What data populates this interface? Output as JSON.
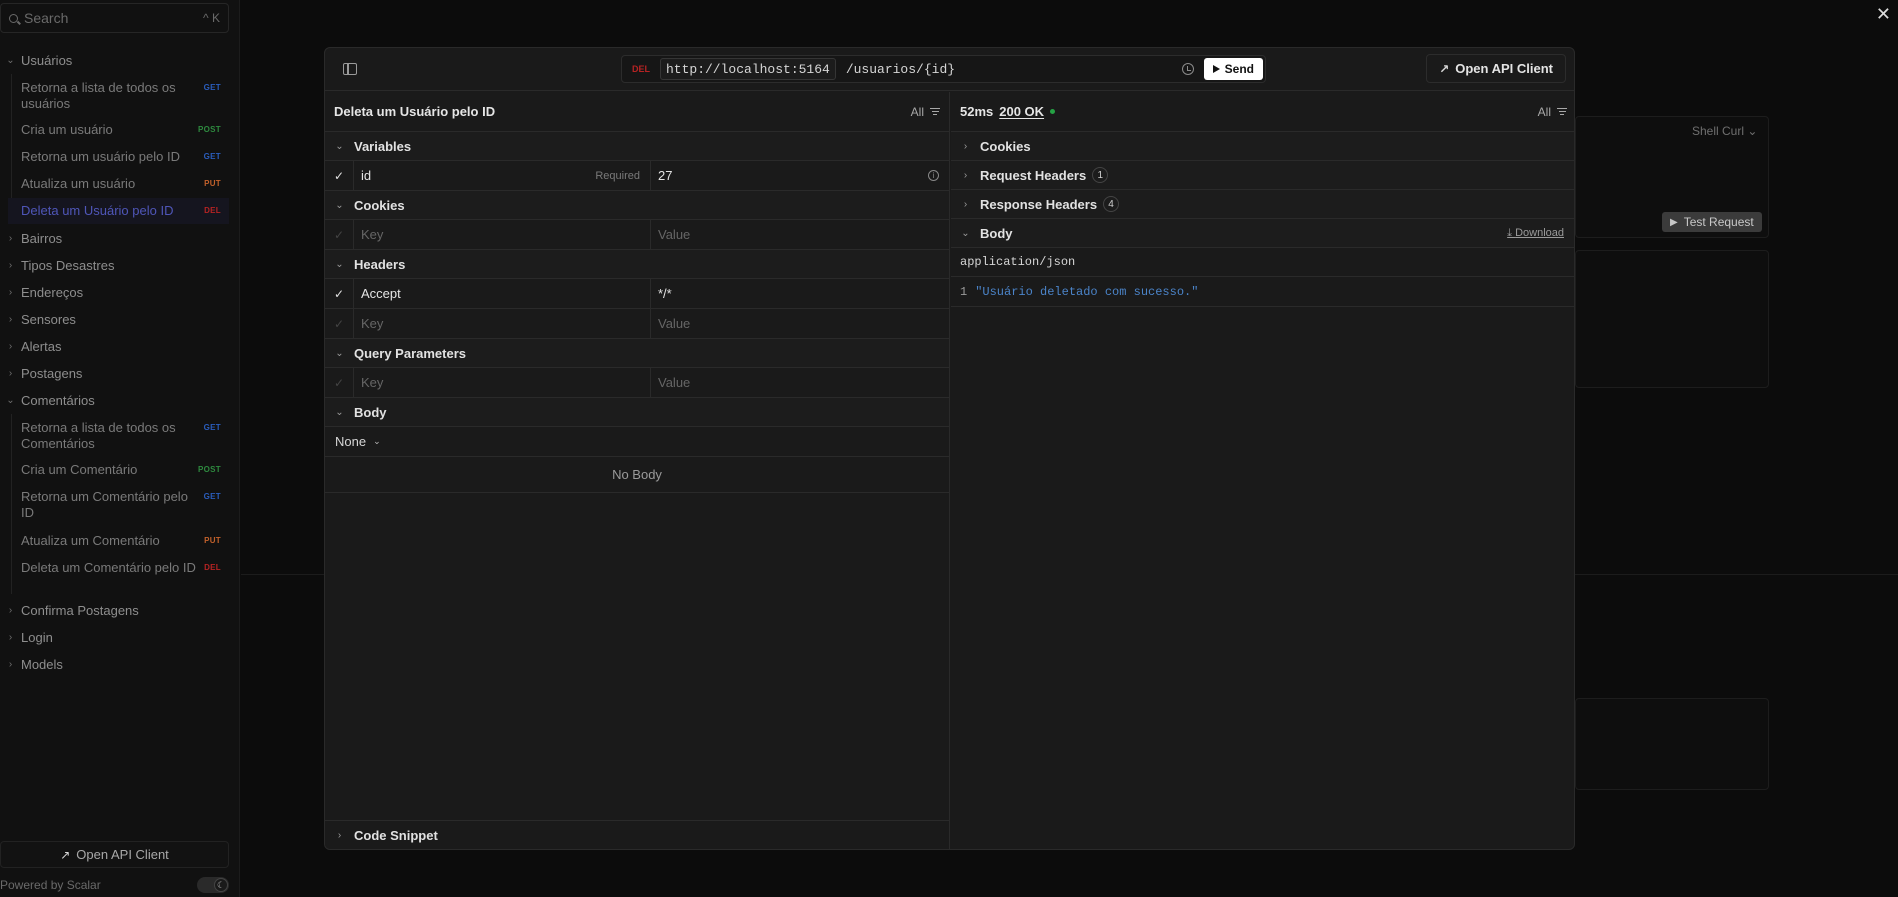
{
  "sidebar": {
    "search_placeholder": "Search",
    "search_shortcut": "^ K",
    "groups": [
      {
        "label": "Usuários",
        "expanded": true
      },
      {
        "label": "Bairros",
        "expanded": false
      },
      {
        "label": "Tipos Desastres",
        "expanded": false
      },
      {
        "label": "Endereços",
        "expanded": false
      },
      {
        "label": "Sensores",
        "expanded": false
      },
      {
        "label": "Alertas",
        "expanded": false
      },
      {
        "label": "Postagens",
        "expanded": false
      },
      {
        "label": "Comentários",
        "expanded": true
      },
      {
        "label": "Confirma Postagens",
        "expanded": false
      },
      {
        "label": "Login",
        "expanded": false
      },
      {
        "label": "Models",
        "expanded": false
      }
    ],
    "usuarios_items": [
      {
        "label": "Retorna a lista de todos os usuários",
        "method": "GET"
      },
      {
        "label": "Cria um usuário",
        "method": "POST"
      },
      {
        "label": "Retorna um usuário pelo ID",
        "method": "GET"
      },
      {
        "label": "Atualiza um usuário",
        "method": "PUT"
      },
      {
        "label": "Deleta um Usuário pelo ID",
        "method": "DEL"
      }
    ],
    "comentarios_items": [
      {
        "label": "Retorna a lista de todos os Comentários",
        "method": "GET"
      },
      {
        "label": "Cria um Comentário",
        "method": "POST"
      },
      {
        "label": "Retorna um Comentário pelo ID",
        "method": "GET"
      },
      {
        "label": "Atualiza um Comentário",
        "method": "PUT"
      },
      {
        "label": "Deleta um Comentário pelo ID",
        "method": "DEL"
      }
    ],
    "footer_button": "Open API Client",
    "powered_by": "Powered by Scalar"
  },
  "background": {
    "shell_label": "Shell Curl",
    "test_request_label": "Test Request"
  },
  "modal": {
    "method": "DEL",
    "host": "http://localhost:5164",
    "path": "/usuarios/{id}",
    "send_label": "Send",
    "open_api_label": "Open API Client",
    "request": {
      "title": "Deleta um Usuário pelo ID",
      "filter_label": "All",
      "variables_label": "Variables",
      "variable": {
        "key": "id",
        "required_label": "Required",
        "value": "27"
      },
      "cookies_label": "Cookies",
      "key_placeholder": "Key",
      "value_placeholder": "Value",
      "headers_label": "Headers",
      "header": {
        "key": "Accept",
        "value": "*/*"
      },
      "query_label": "Query Parameters",
      "body_label": "Body",
      "body_type": "None",
      "no_body_label": "No Body",
      "code_snippet_label": "Code Snippet"
    },
    "response": {
      "timing": "52ms",
      "status": "200 OK",
      "filter_label": "All",
      "cookies_label": "Cookies",
      "request_headers_label": "Request Headers",
      "request_headers_count": "1",
      "response_headers_label": "Response Headers",
      "response_headers_count": "4",
      "body_label": "Body",
      "download_label": "Download",
      "content_type": "application/json",
      "line_number": "1",
      "body_text": "\"Usuário deletado com sucesso.\""
    }
  },
  "colors": {
    "get": "#2a5dbc",
    "post": "#2e8a3f",
    "put": "#c2612b",
    "del": "#b62323",
    "status_ok": "#25a244"
  }
}
